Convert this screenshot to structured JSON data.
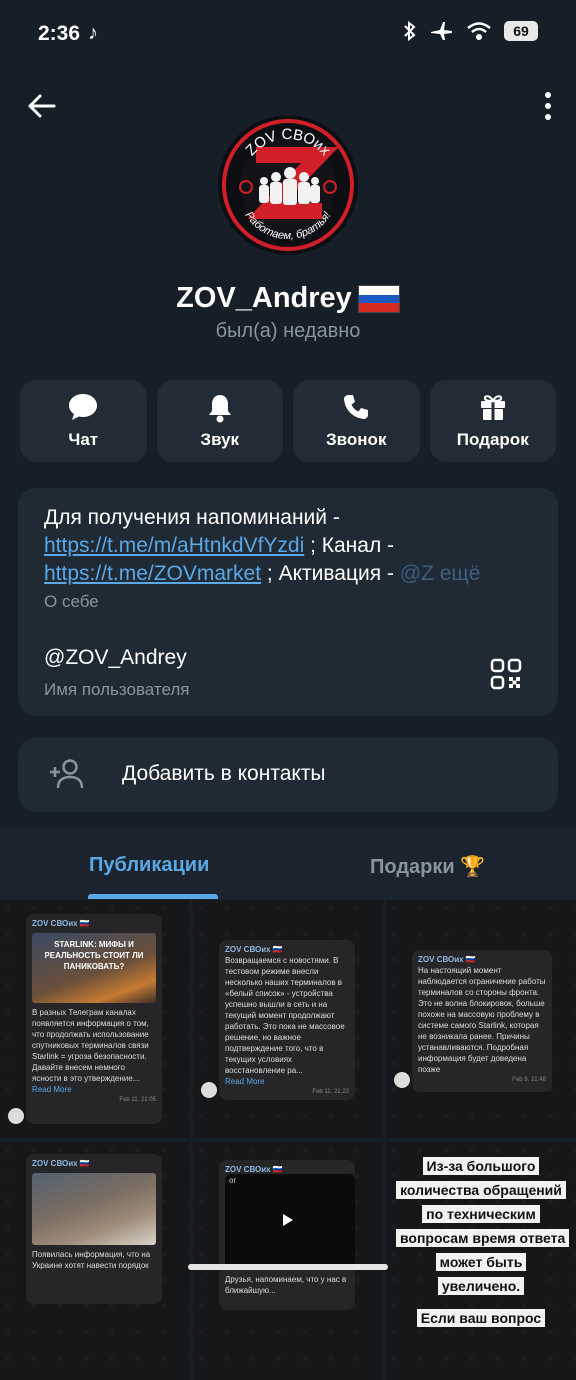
{
  "status_bar": {
    "time": "2:36",
    "battery": "69"
  },
  "profile": {
    "name": "ZOV_Andrey",
    "flag": "🇷🇺",
    "status": "был(а) недавно",
    "avatar_text": {
      "top": "ZOV СВОих",
      "bottom": "Работаем, братья!"
    }
  },
  "actions": [
    {
      "label": "Чат",
      "icon": "chat-bubble-icon"
    },
    {
      "label": "Звук",
      "icon": "bell-icon"
    },
    {
      "label": "Звонок",
      "icon": "phone-icon"
    },
    {
      "label": "Подарок",
      "icon": "gift-icon"
    }
  ],
  "info": {
    "bio_part1": "Для получения напоминаний - ",
    "bio_link1": "https://t.me/m/aHtnkdVfYzdi",
    "bio_part2": " ; Канал - ",
    "bio_link2": "https://t.me/ZOVmarket",
    "bio_part3": " ; Активация - ",
    "bio_fade": "@Z",
    "bio_more": "ещё",
    "bio_label": "О себе",
    "username": "@ZOV_Andrey",
    "username_label": "Имя пользователя"
  },
  "add_contact": {
    "label": "Добавить в контакты"
  },
  "tabs": [
    {
      "label": "Публикации",
      "active": true
    },
    {
      "label": "Подарки 🏆",
      "active": false
    }
  ],
  "posts": [
    {
      "channel": "ZOV СВОих 🇷🇺",
      "image_caption": "STARLINK: МИФЫ И РЕАЛЬНОСТЬ СТОИТ ЛИ ПАНИКОВАТЬ?",
      "text": "В разных Телеграм каналах появляется информация о том, что продолжать использование спутниковых терминалов связи Starlink = угроза безопасности. Давайте внесем немного ясности в это утверждение...",
      "read_more": "Read More",
      "date": "Feb 11, 21:05"
    },
    {
      "channel": "ZOV СВОих 🇷🇺",
      "text": "Возвращаемся с новостями. В тестовом режиме внесли несколько наших терминалов в «белый список» - устройства успешно вышли в сеть и на текущий момент продолжают работать. Это пока не массовое решение, но важное подтверждение того, что в текущих условиях восстановление ра...",
      "read_more": "Read More",
      "date": "Feb 11, 21:22"
    },
    {
      "channel": "ZOV СВОих 🇷🇺",
      "text": "На настоящий момент наблюдается ограничение работы терминалов со стороны фронта. Это не волна блокировок, больше похоже на массовую проблему в системе самого Starlink, которая не возникала ранее. Причины устанавливаются. Подробная информация будет доведена позже",
      "date": "Feb 9, 21:48"
    },
    {
      "channel": "ZOV СВОих 🇷🇺",
      "text": "Появилась информация, что на Украине хотят навести порядок"
    },
    {
      "channel": "ZOV СВОих 🇷🇺",
      "video_text": "ог",
      "text": "Друзья, напоминаем, что у нас в ближайшую..."
    },
    {
      "text": "Из-за большого количества обращений по техническим вопросам время ответа может быть увеличено.",
      "text2": "Если ваш вопрос"
    }
  ],
  "colors": {
    "accent": "#5aa8e6",
    "background": "#161e27",
    "card": "#202a34",
    "logo_red": "#d11f2a"
  }
}
